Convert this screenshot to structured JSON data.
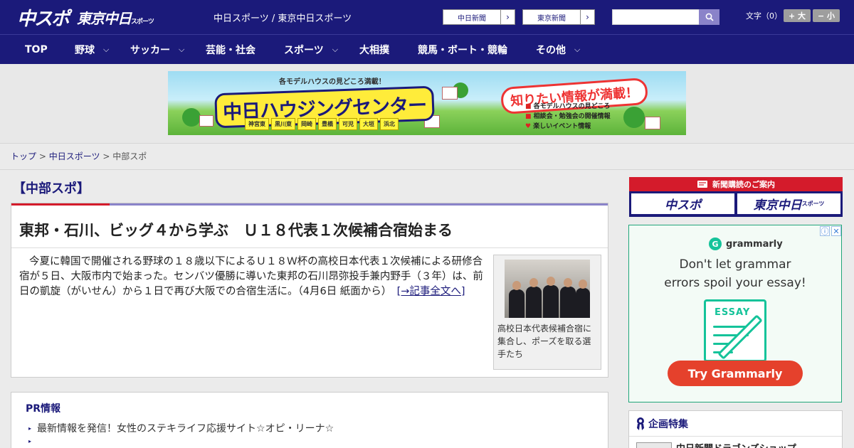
{
  "header": {
    "logo_main": "中スポ",
    "logo_sub": "東京中日",
    "logo_sub_small": "スポーツ",
    "site_title": "中日スポーツ / 東京中日スポーツ",
    "links": [
      {
        "label": "中日新聞",
        "arrow": "›"
      },
      {
        "label": "東京新聞",
        "arrow": "›"
      }
    ],
    "search_placeholder": "",
    "font_size_label": "文字（0）",
    "font_larger": "+ 大",
    "font_smaller": "− 小"
  },
  "nav": {
    "items": [
      {
        "label": "TOP",
        "has_menu": false
      },
      {
        "label": "野球",
        "has_menu": true
      },
      {
        "label": "サッカー",
        "has_menu": true
      },
      {
        "label": "芸能・社会",
        "has_menu": false
      },
      {
        "label": "スポーツ",
        "has_menu": true
      },
      {
        "label": "大相撲",
        "has_menu": false
      },
      {
        "label": "競馬・ボート・競輪",
        "has_menu": false
      },
      {
        "label": "その他",
        "has_menu": true
      }
    ],
    "chevron": "⌵"
  },
  "banner": {
    "top_text": "各モデルハウスの見どころ満載！",
    "main_text": "中日ハウジングセンター",
    "badge": "知りたい情報が満載！",
    "info": [
      "各モデルハウスの見どころ",
      "相談会・勉強会の開催情報",
      "楽しいイベント情報"
    ],
    "cities": [
      "神宮東",
      "黒川東",
      "岡崎",
      "豊橋",
      "可児",
      "大垣",
      "浜北"
    ]
  },
  "breadcrumb": {
    "items": [
      "トップ",
      "中日スポーツ",
      "中部スポ"
    ],
    "separator": ">"
  },
  "article": {
    "section": "【中部スポ】",
    "title": "東邦・石川、ビッグ４から学ぶ　Ｕ１８代表１次候補合宿始まる",
    "body": "今夏に韓国で開催される野球の１８歳以下によるＵ１８Ｗ杯の高校日本代表１次候補による研修合宿が５日、大阪市内で始まった。センバツ優勝に導いた東邦の石川昂弥投手兼内野手（３年）は、前日の凱旋（がいせん）から１日で再び大阪での合宿生活に。（4月6日 紙面から）",
    "more_link": "[→記事全文へ]",
    "photo_caption": "高校日本代表候補合宿に集合し、ポーズを取る選手たち"
  },
  "pr": {
    "title": "PR情報",
    "items": [
      "最新情報を発信！女性のステキライフ応援サイト☆オピ・リーナ☆",
      ""
    ],
    "bullet": "▸"
  },
  "sidebar": {
    "subscribe_head": "新聞購読のご案内",
    "subscribe_btn1": "中スポ",
    "subscribe_btn2": "東京中日",
    "subscribe_btn2_small": "スポーツ",
    "ad": {
      "brand": "grammarly",
      "brand_icon": "G",
      "headline_1": "Don't let grammar",
      "headline_2": "errors spoil your essay!",
      "essay_tag": "ESSAY",
      "cta": "Try Grammarly",
      "info_icon": "ⓘ",
      "close_icon": "✕"
    },
    "feature_title": "企画特集",
    "feature_item": "中日新聞ドラゴンズショップ"
  },
  "colors": {
    "brand_navy": "#1b1a7a",
    "accent_red": "#d41b2b",
    "accent_purple": "#8a83c9",
    "grammarly_green": "#15c39a"
  }
}
